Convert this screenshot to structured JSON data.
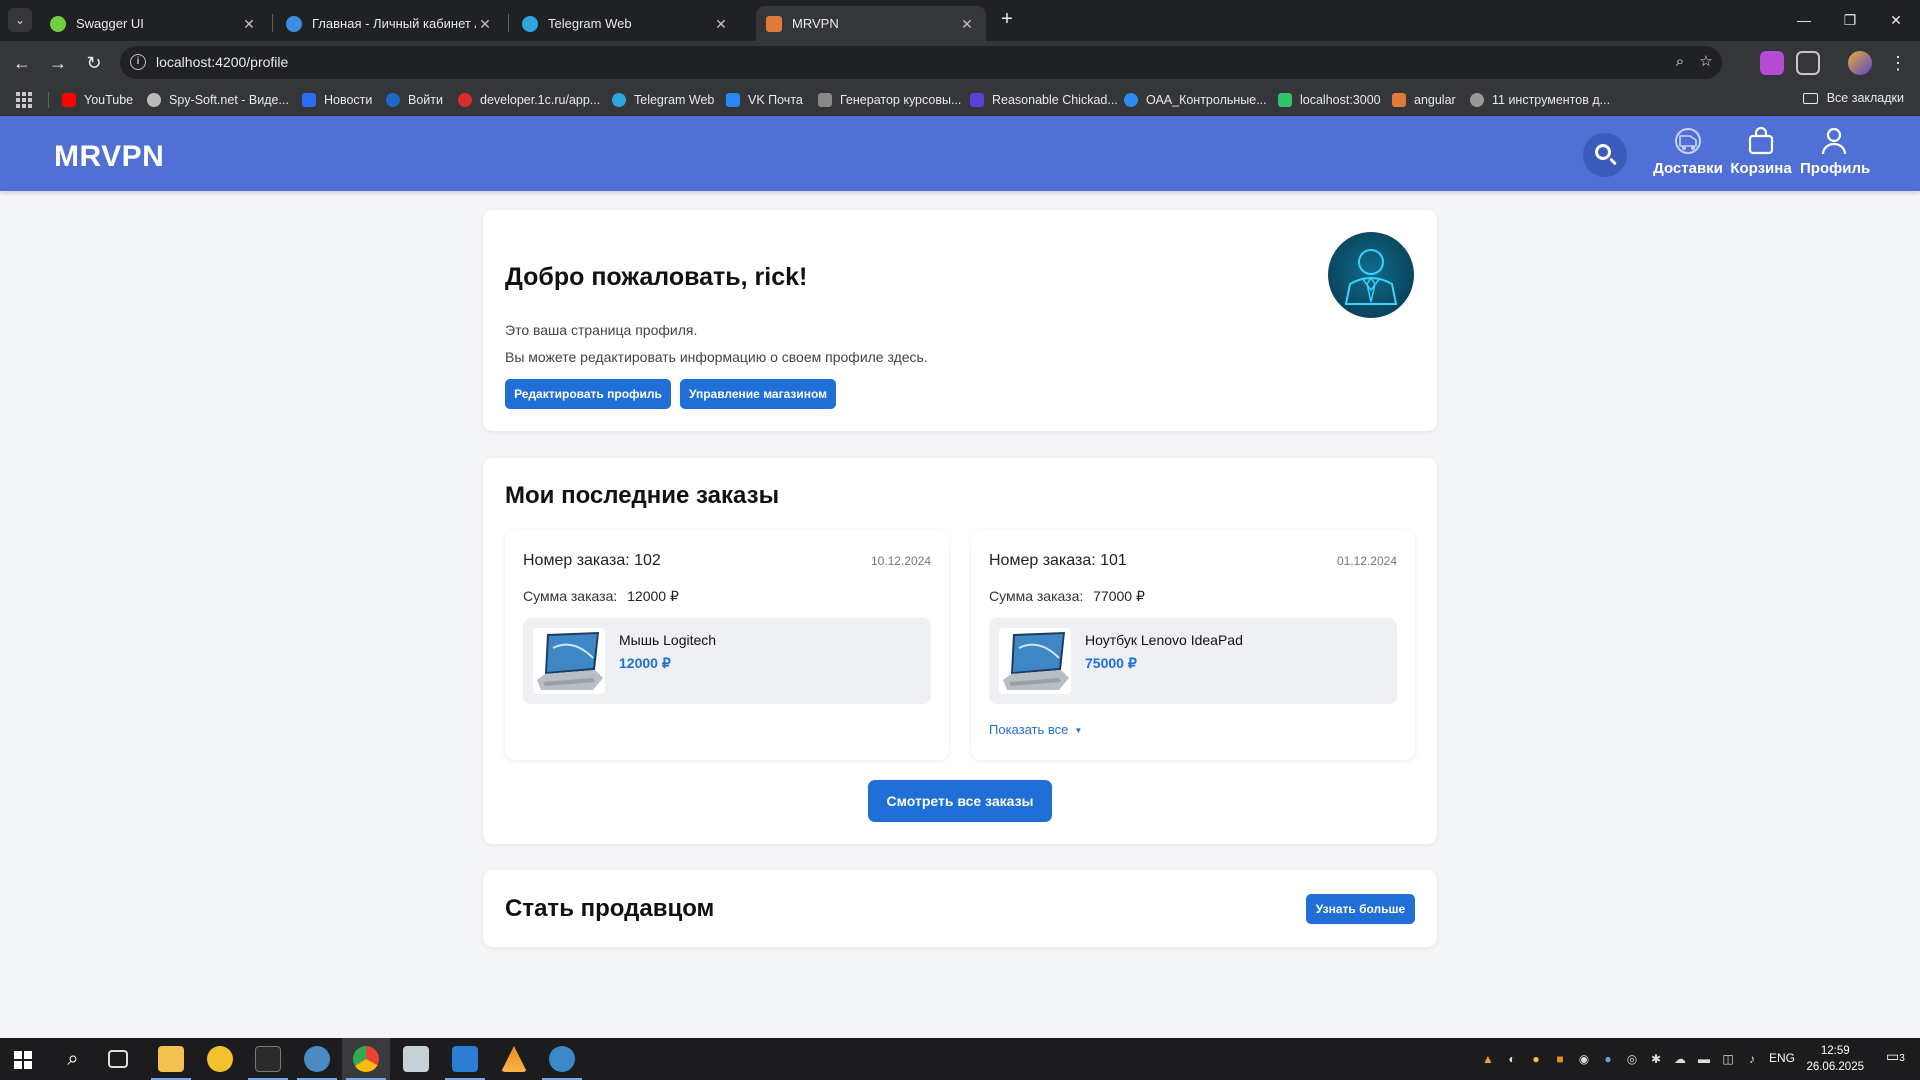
{
  "browser": {
    "tabs": [
      {
        "title": "Swagger UI",
        "favicon_color": "#6fcf3f"
      },
      {
        "title": "Главная - Личный кабинет Ar",
        "favicon_color": "#3c8de0"
      },
      {
        "title": "Telegram Web",
        "favicon_color": "#2fa6e0"
      },
      {
        "title": "MRVPN",
        "favicon_color": "#e07a3a"
      }
    ],
    "active_tab_index": 3,
    "url": "localhost:4200/profile",
    "bookmarks": [
      {
        "label": "YouTube",
        "icon_color": "#ff0000"
      },
      {
        "label": "Spy-Soft.net - Виде...",
        "icon_color": "#bbbbbb"
      },
      {
        "label": "Новости",
        "icon_color": "#2b6cf0"
      },
      {
        "label": "Войти",
        "icon_color": "#1b6ac9"
      },
      {
        "label": "developer.1c.ru/app...",
        "icon_color": "#d92c2c"
      },
      {
        "label": "Telegram Web",
        "icon_color": "#2fa6e0"
      },
      {
        "label": "VK Почта",
        "icon_color": "#2787f5"
      },
      {
        "label": "Генератор курсовы...",
        "icon_color": "#888888"
      },
      {
        "label": "Reasonable Chickad...",
        "icon_color": "#5b3fd6"
      },
      {
        "label": "ОАА_Контрольные...",
        "icon_color": "#2b8af0"
      },
      {
        "label": "localhost:3000",
        "icon_color": "#2fc46b"
      },
      {
        "label": "angular",
        "icon_color": "#e07a3a"
      },
      {
        "label": "11 инструментов д...",
        "icon_color": "#999999"
      }
    ],
    "all_bookmarks_label": "Все закладки"
  },
  "site": {
    "logo": "MRVPN",
    "header_links": [
      {
        "label": "Доставки",
        "icon": "delivery-icon"
      },
      {
        "label": "Корзина",
        "icon": "cart-icon"
      },
      {
        "label": "Профиль",
        "icon": "profile-icon"
      }
    ],
    "accent_color": "#5170d6",
    "button_color": "#1f6fd6"
  },
  "welcome": {
    "title": "Добро пожаловать, rick!",
    "line1": "Это ваша страница профиля.",
    "line2": "Вы можете редактировать информацию о своем профиле здесь.",
    "edit_button": "Редактировать профиль",
    "manage_button": "Управление магазином"
  },
  "orders": {
    "title": "Мои последние заказы",
    "sum_label": "Сумма заказа:",
    "items": [
      {
        "number_text": "Номер заказа: 102",
        "date": "10.12.2024",
        "sum": "12000 ₽",
        "product_name": "Мышь Logitech",
        "product_price": "12000 ₽"
      },
      {
        "number_text": "Номер заказа: 101",
        "date": "01.12.2024",
        "sum": "77000 ₽",
        "product_name": "Ноутбук Lenovo IdeaPad",
        "product_price": "75000 ₽",
        "show_all": "Показать все"
      }
    ],
    "view_all_button": "Смотреть все заказы"
  },
  "seller": {
    "title": "Стать продавцом",
    "button": "Узнать больше"
  },
  "taskbar": {
    "lang": "ENG",
    "time": "12:59",
    "date": "26.06.2025",
    "notif_count": "3"
  }
}
